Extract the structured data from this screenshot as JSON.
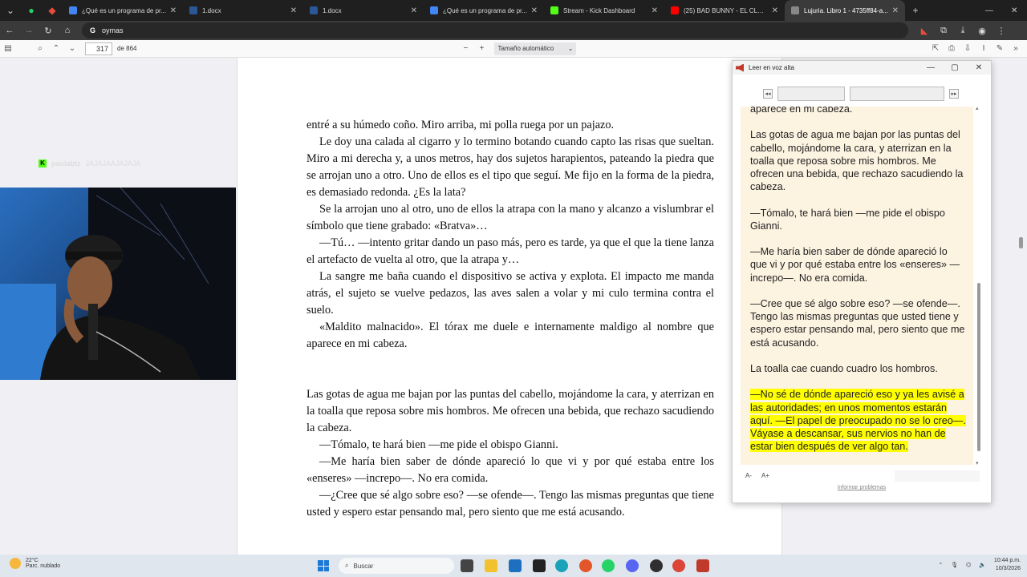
{
  "browser": {
    "tabs": [
      {
        "title": "¿Qué es un programa de pr...",
        "color": "#4285f4",
        "active": false
      },
      {
        "title": "1.docx",
        "color": "#2b5797",
        "active": false
      },
      {
        "title": "1.docx",
        "color": "#2b5797",
        "active": false
      },
      {
        "title": "¿Qué es un programa de pr...",
        "color": "#4285f4",
        "active": false
      },
      {
        "title": "Stream - Kick Dashboard",
        "color": "#53fc18",
        "active": false
      },
      {
        "title": "(25) BAD BUNNY - EL CLÚB |...",
        "color": "#ff0000",
        "active": false
      },
      {
        "title": "Lujuria. Libro 1 - 4735ff84-a...",
        "color": "#888888",
        "active": true
      }
    ],
    "address": "oymas"
  },
  "pdf_toolbar": {
    "page_number": "317",
    "page_total": "de 864",
    "zoom": "Tamaño automático"
  },
  "stream_overlay": {
    "username": "paolabtz",
    "message": "JAJAJAAJAJAJA"
  },
  "page_text": [
    {
      "text": "entré a su húmedo coño. Miro arriba, mi polla ruega por un pajazo.",
      "indent": false
    },
    {
      "text": "Le doy una calada al cigarro y lo termino botando cuando capto las risas que sueltan. Miro a mi derecha y, a unos metros, hay dos sujetos harapientos, pateando la piedra que se arrojan uno a otro. Uno de ellos es el tipo que seguí. Me fijo en la forma de la piedra, es demasiado redonda. ¿Es la lata?",
      "indent": true
    },
    {
      "text": "Se la arrojan uno al otro, uno de ellos la atrapa con la mano y alcanzo a vislumbrar el símbolo que tiene grabado: «Bratva»…",
      "indent": true
    },
    {
      "text": "—Tú… —intento gritar dando un paso más, pero es tarde, ya que el que la tiene lanza el artefacto de vuelta al otro, que la atrapa y…",
      "indent": true
    },
    {
      "text": "La sangre me baña cuando el dispositivo se activa y explota. El impacto me manda atrás, el sujeto se vuelve pedazos, las aves salen a volar y mi culo termina contra el suelo.",
      "indent": true
    },
    {
      "text": "«Maldito malnacido». El tórax me duele e internamente maldigo al nombre que aparece en mi cabeza.",
      "indent": true
    }
  ],
  "page_text_2": [
    {
      "text": "Las gotas de agua me bajan por las puntas del cabello, mojándome la cara, y aterrizan en la toalla que reposa sobre mis hombros. Me ofrecen una bebida, que rechazo sacudiendo la cabeza.",
      "indent": false
    },
    {
      "text": "—Tómalo, te hará bien —me pide el obispo Gianni.",
      "indent": true
    },
    {
      "text": "—Me haría bien saber de dónde apareció lo que vi y por qué estaba entre los «enseres» —increpo—. No era comida.",
      "indent": true
    },
    {
      "text": "—¿Cree que sé algo sobre eso? —se ofende—. Tengo las mismas preguntas que tiene usted y espero estar pensando mal, pero siento que me está acusando.",
      "indent": true
    }
  ],
  "read_aloud": {
    "title": "Leer en voz alta",
    "paragraphs": [
      "aparece en mi cabeza.",
      "Las gotas de agua me bajan por las puntas del cabello, mojándome la cara, y aterrizan en la toalla que reposa sobre mis hombros. Me ofrecen una bebida, que rechazo sacudiendo la cabeza.",
      "—Tómalo, te hará bien —me pide el obispo Gianni.",
      "—Me haría bien saber de dónde apareció lo que vi y por qué estaba entre los «enseres» —increpo—. No era comida.",
      "—Cree que sé algo sobre eso? —se ofende—. Tengo las mismas preguntas que usted tiene y espero estar pensando mal, pero siento que me está acusando.",
      "La toalla cae cuando cuadro los hombros."
    ],
    "highlighted": "—No sé de dónde apareció eso y ya les avisé a las autoridades; en unos momentos estarán aquí. —El papel de preocupado no se lo creo—. Váyase a descansar, sus nervios no han de estar bien después de ver algo tan.",
    "font_smaller": "A-",
    "font_larger": "A+",
    "report": "informar problemas",
    "highlight_color": "#ffff00",
    "background_color": "#fdf3e1"
  },
  "taskbar": {
    "temperature": "22°C",
    "weather": "Parc. nublado",
    "search_placeholder": "Buscar",
    "time": "10:44 p.m.",
    "date": "10/3/2026"
  }
}
